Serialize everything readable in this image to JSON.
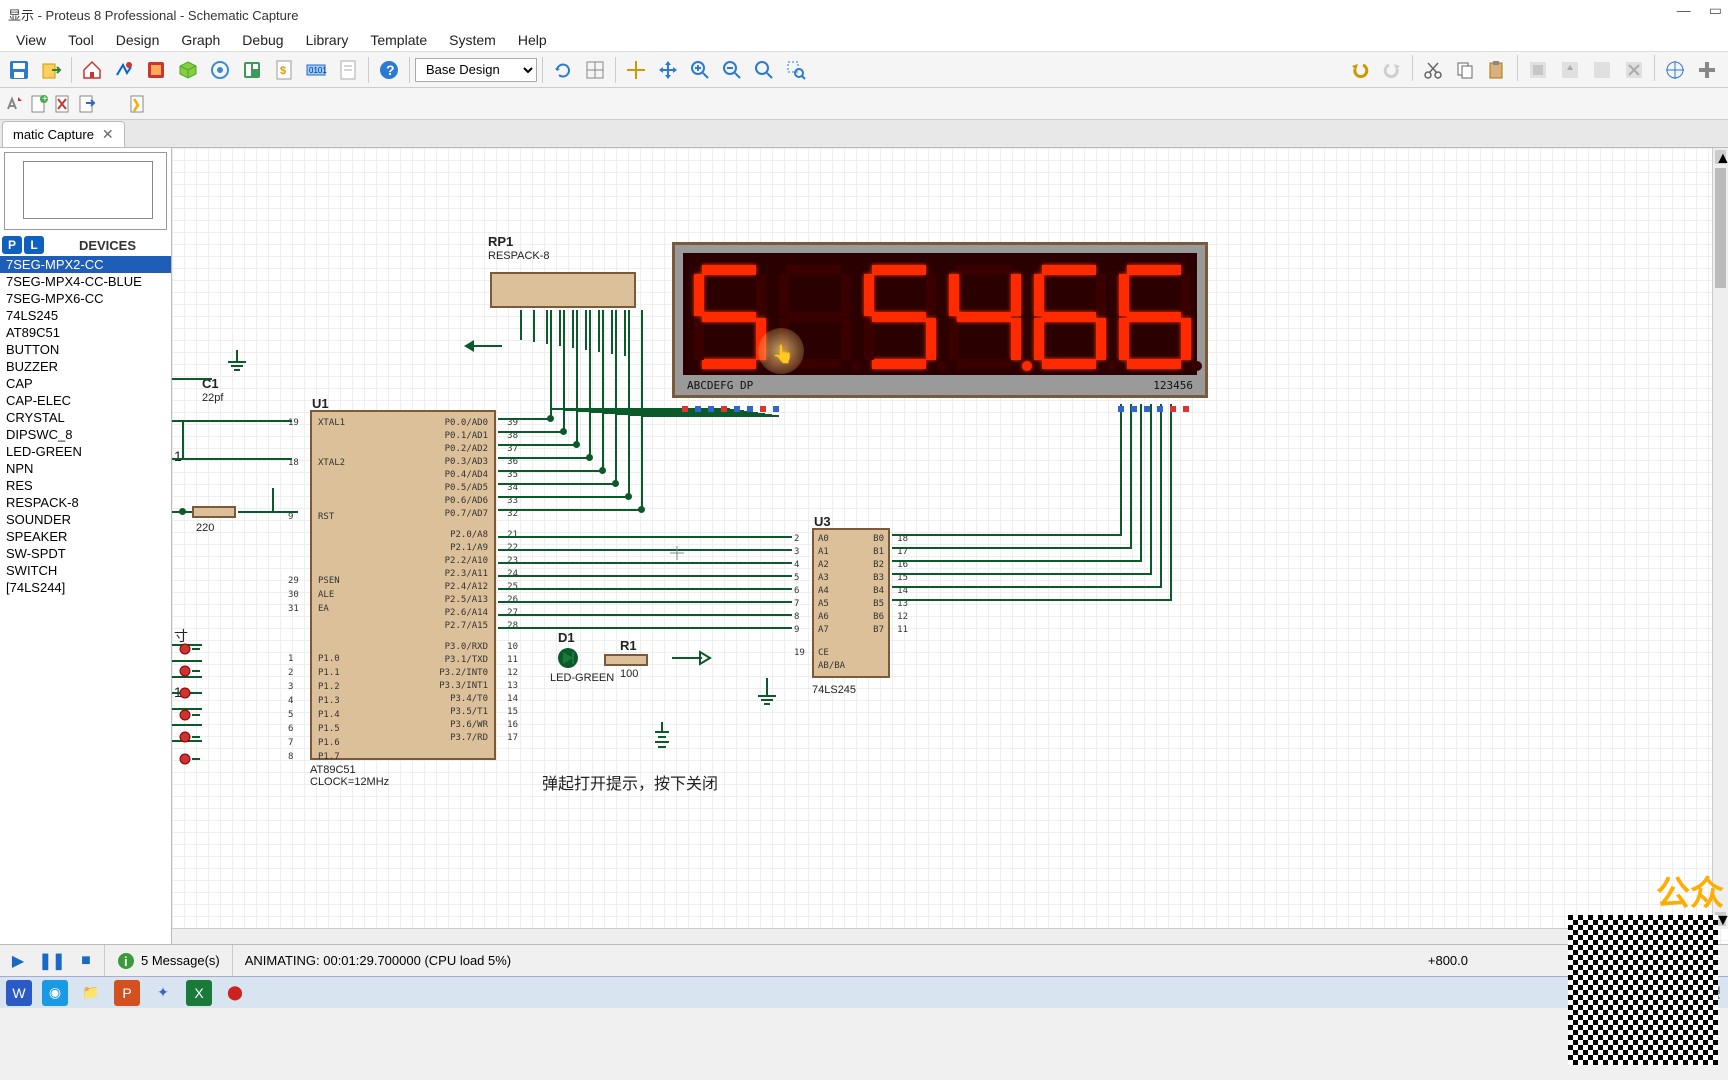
{
  "title": "显示 - Proteus 8 Professional - Schematic Capture",
  "menu": [
    "View",
    "Tool",
    "Design",
    "Graph",
    "Debug",
    "Library",
    "Template",
    "System",
    "Help"
  ],
  "design_selector": "Base Design",
  "tab": {
    "label": "matic Capture"
  },
  "devices_header": "DEVICES",
  "devices": [
    "7SEG-MPX2-CC",
    "7SEG-MPX4-CC-BLUE",
    "7SEG-MPX6-CC",
    "74LS245",
    "AT89C51",
    "BUTTON",
    "BUZZER",
    "CAP",
    "CAP-ELEC",
    "CRYSTAL",
    "DIPSWC_8",
    "LED-GREEN",
    "NPN",
    "RES",
    "RESPACK-8",
    "SOUNDER",
    "SPEAKER",
    "SW-SPDT",
    "SWITCH",
    "[74LS244]"
  ],
  "devices_selected": 0,
  "status": {
    "messages": "5 Message(s)",
    "anim": "ANIMATING: 00:01:29.700000 (CPU load 5%)",
    "coord": "+800.0"
  },
  "canvas": {
    "rp1": {
      "ref": "RP1",
      "val": "RESPACK-8"
    },
    "u1": {
      "ref": "U1",
      "val": "AT89C51",
      "clock": "CLOCK=12MHz"
    },
    "u3": {
      "ref": "U3",
      "val": "74LS245"
    },
    "c1": {
      "ref": "C1",
      "val": "22pf"
    },
    "r1": {
      "ref": "R1",
      "val": "100"
    },
    "d1": {
      "ref": "D1",
      "val": "LED-GREEN"
    },
    "r_rst": "220",
    "pinnum_left_1": "1",
    "pinnum_left_2": "1",
    "time_note": "寸",
    "segpins": "ABCDEFG  DP",
    "segdigits": "123456",
    "u1_pins_left": [
      {
        "n": "19",
        "lbl": "XTAL1"
      },
      {
        "n": "18",
        "lbl": "XTAL2"
      },
      {
        "n": "9",
        "lbl": "RST"
      },
      {
        "n": "29",
        "lbl": "PSEN"
      },
      {
        "n": "30",
        "lbl": "ALE"
      },
      {
        "n": "31",
        "lbl": "EA"
      },
      {
        "n": "1",
        "lbl": "P1.0"
      },
      {
        "n": "2",
        "lbl": "P1.1"
      },
      {
        "n": "3",
        "lbl": "P1.2"
      },
      {
        "n": "4",
        "lbl": "P1.3"
      },
      {
        "n": "5",
        "lbl": "P1.4"
      },
      {
        "n": "6",
        "lbl": "P1.5"
      },
      {
        "n": "7",
        "lbl": "P1.6"
      },
      {
        "n": "8",
        "lbl": "P1.7"
      }
    ],
    "u1_pins_right": [
      {
        "n": "39",
        "lbl": "P0.0/AD0"
      },
      {
        "n": "38",
        "lbl": "P0.1/AD1"
      },
      {
        "n": "37",
        "lbl": "P0.2/AD2"
      },
      {
        "n": "36",
        "lbl": "P0.3/AD3"
      },
      {
        "n": "35",
        "lbl": "P0.4/AD4"
      },
      {
        "n": "34",
        "lbl": "P0.5/AD5"
      },
      {
        "n": "33",
        "lbl": "P0.6/AD6"
      },
      {
        "n": "32",
        "lbl": "P0.7/AD7"
      },
      {
        "n": "21",
        "lbl": "P2.0/A8"
      },
      {
        "n": "22",
        "lbl": "P2.1/A9"
      },
      {
        "n": "23",
        "lbl": "P2.2/A10"
      },
      {
        "n": "24",
        "lbl": "P2.3/A11"
      },
      {
        "n": "25",
        "lbl": "P2.4/A12"
      },
      {
        "n": "26",
        "lbl": "P2.5/A13"
      },
      {
        "n": "27",
        "lbl": "P2.6/A14"
      },
      {
        "n": "28",
        "lbl": "P2.7/A15"
      },
      {
        "n": "10",
        "lbl": "P3.0/RXD"
      },
      {
        "n": "11",
        "lbl": "P3.1/TXD"
      },
      {
        "n": "12",
        "lbl": "P3.2/INT0"
      },
      {
        "n": "13",
        "lbl": "P3.3/INT1"
      },
      {
        "n": "14",
        "lbl": "P3.4/T0"
      },
      {
        "n": "15",
        "lbl": "P3.5/T1"
      },
      {
        "n": "16",
        "lbl": "P3.6/WR"
      },
      {
        "n": "17",
        "lbl": "P3.7/RD"
      }
    ],
    "u3_pins_left": [
      {
        "n": "2",
        "lbl": "A0"
      },
      {
        "n": "3",
        "lbl": "A1"
      },
      {
        "n": "4",
        "lbl": "A2"
      },
      {
        "n": "5",
        "lbl": "A3"
      },
      {
        "n": "6",
        "lbl": "A4"
      },
      {
        "n": "7",
        "lbl": "A5"
      },
      {
        "n": "8",
        "lbl": "A6"
      },
      {
        "n": "9",
        "lbl": "A7"
      },
      {
        "n": "19",
        "lbl": "CE"
      },
      {
        "n": "",
        "lbl": "AB/BA"
      }
    ],
    "u3_pins_right": [
      {
        "n": "18",
        "lbl": "B0"
      },
      {
        "n": "17",
        "lbl": "B1"
      },
      {
        "n": "16",
        "lbl": "B2"
      },
      {
        "n": "15",
        "lbl": "B3"
      },
      {
        "n": "14",
        "lbl": "B4"
      },
      {
        "n": "13",
        "lbl": "B5"
      },
      {
        "n": "12",
        "lbl": "B6"
      },
      {
        "n": "11",
        "lbl": "B7"
      }
    ],
    "caption_cn": "弹起打开提示，按下关闭",
    "display_digits": [
      {
        "a": 1,
        "b": 0,
        "c": 1,
        "d": 1,
        "e": 0,
        "f": 1,
        "g": 1,
        "dp": 0
      },
      {
        "a": 0,
        "b": 0,
        "c": 0,
        "d": 0,
        "e": 0,
        "f": 0,
        "g": 0,
        "dp": 0
      },
      {
        "a": 1,
        "b": 0,
        "c": 1,
        "d": 1,
        "e": 0,
        "f": 1,
        "g": 1,
        "dp": 0
      },
      {
        "a": 0,
        "b": 1,
        "c": 1,
        "d": 0,
        "e": 0,
        "f": 1,
        "g": 1,
        "dp": 1
      },
      {
        "a": 1,
        "b": 0,
        "c": 1,
        "d": 1,
        "e": 1,
        "f": 1,
        "g": 1,
        "dp": 0
      },
      {
        "a": 1,
        "b": 0,
        "c": 1,
        "d": 1,
        "e": 1,
        "f": 1,
        "g": 1,
        "dp": 0
      }
    ]
  },
  "watermark": "公众"
}
